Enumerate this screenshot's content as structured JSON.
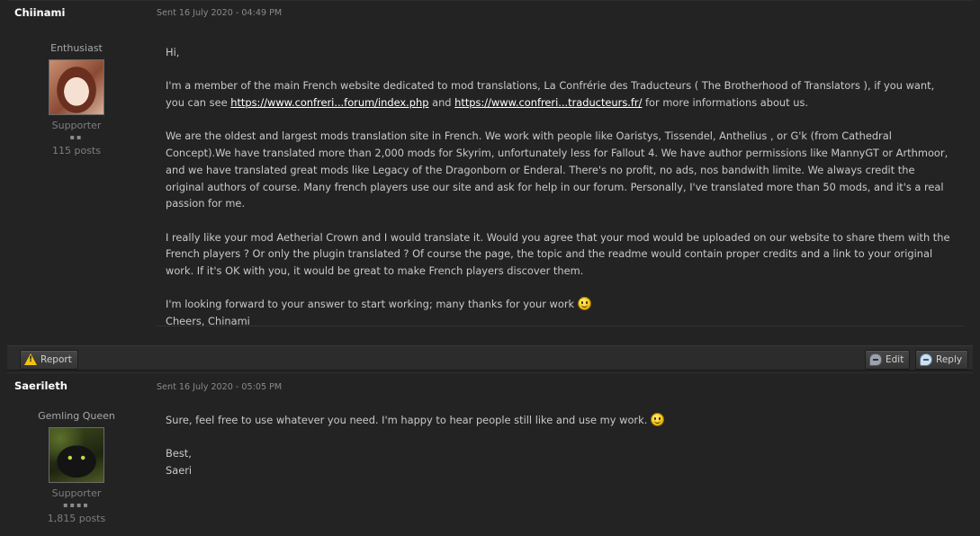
{
  "posts": [
    {
      "author": "Chiinami",
      "date": "Sent 16 July 2020 - 04:49 PM",
      "title": "Enthusiast",
      "group": "Supporter",
      "pips": "▪▪",
      "posts": "115 posts",
      "paragraphs": {
        "greeting": "Hi,",
        "p2_text_a": "I'm a member of the main French website dedicated to mod translations, La Confrérie des Traducteurs ( The Brotherhood of Translators ), if you want, you can see ",
        "p2_link1": "https://www.confreri...forum/index.php",
        "p2_text_b": " and ",
        "p2_link2": "https://www.confreri...traducteurs.fr/",
        "p2_text_c": " for more informations about us.",
        "p3": "We are the oldest and largest mods translation site in French. We work with people like Oaristys, Tissendel, Anthelius , or G'k (from Cathedral Concept).We have translated more than 2,000 mods for Skyrim, unfortunately less for Fallout 4. We have author permissions like MannyGT or Arthmoor, and we have translated great mods like Legacy of the Dragonborn or Enderal. There's no profit, no ads, nos bandwith limite. We always credit the original authors of course. Many french players use our site and ask for help in our forum. Personally, I've translated more than 50 mods, and it's a real passion for me.",
        "p4": "I really like your mod Aetherial Crown and I would translate it. Would you agree that your mod would be uploaded on our website to share them with the French players ? Or only the plugin translated ? Of course the page, the topic and the readme would contain proper credits and a link to your original work. If it's OK with you, it would be great to make French players discover them.",
        "p5": "I'm looking forward to your answer to start working; many thanks for your work ",
        "p5_sign": "Cheers, Chinami"
      }
    },
    {
      "author": "Saerileth",
      "date": "Sent 16 July 2020 - 05:05 PM",
      "title": "Gemling Queen",
      "group": "Supporter",
      "pips": "▪▪▪▪",
      "posts": "1,815 posts",
      "paragraphs": {
        "p1": "Sure, feel free to use whatever you need. I'm happy to hear people still like and use my work. ",
        "p2_a": "Best,",
        "p2_b": "Saeri"
      }
    }
  ],
  "actions": {
    "report": "Report",
    "edit": "Edit",
    "reply": "Reply"
  },
  "icons": {
    "report": "warning-icon",
    "edit": "edit-bubble-icon",
    "reply": "reply-bubble-icon",
    "smiley": "smiley-icon"
  },
  "colors": {
    "background": "#232323",
    "author": "#ffffff",
    "link": "#ffffff",
    "text": "#c9c9c9",
    "meta": "#8a8a8a"
  }
}
